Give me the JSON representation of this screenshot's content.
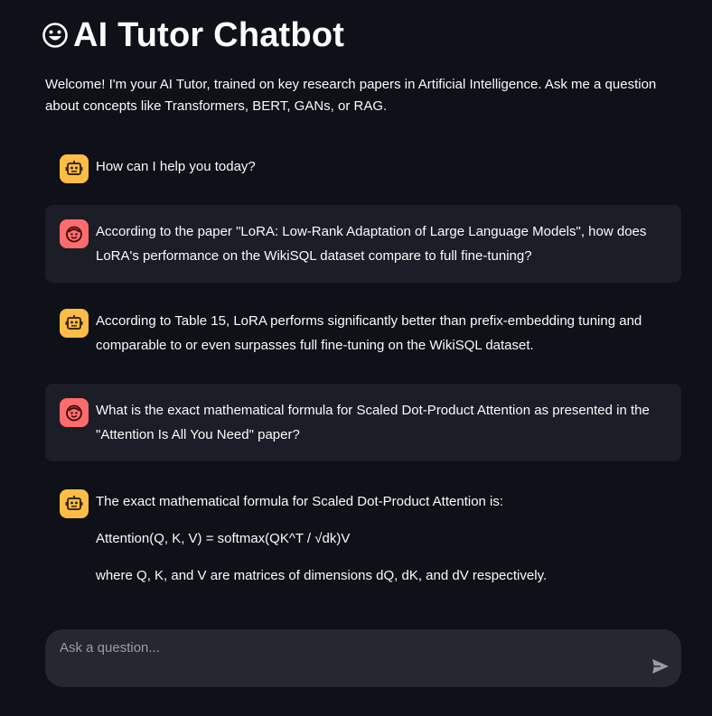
{
  "header": {
    "title": "AI Tutor Chatbot",
    "title_icon": "grinning-face-icon"
  },
  "welcome_text": "Welcome! I'm your AI Tutor, trained on key research papers in Artificial Intelligence. Ask me a question about concepts like Transformers, BERT, GANs, or RAG.",
  "messages": [
    {
      "role": "assistant",
      "icon": "robot-face-icon",
      "paragraphs": [
        "How can I help you today?"
      ]
    },
    {
      "role": "user",
      "icon": "smiley-face-icon",
      "paragraphs": [
        "According to the paper \"LoRA: Low-Rank Adaptation of Large Language Models\", how does LoRA's performance on the WikiSQL dataset compare to full fine-tuning?"
      ]
    },
    {
      "role": "assistant",
      "icon": "robot-face-icon",
      "paragraphs": [
        "According to Table 15, LoRA performs significantly better than prefix-embedding tuning and comparable to or even surpasses full fine-tuning on the WikiSQL dataset."
      ]
    },
    {
      "role": "user",
      "icon": "smiley-face-icon",
      "paragraphs": [
        "What is the exact mathematical formula for Scaled Dot-Product Attention as presented in the \"Attention Is All You Need\" paper?"
      ]
    },
    {
      "role": "assistant",
      "icon": "robot-face-icon",
      "paragraphs": [
        "The exact mathematical formula for Scaled Dot-Product Attention is:",
        "Attention(Q, K, V) = softmax(QK^T / √dk)V",
        "where Q, K, and V are matrices of dimensions dQ, dK, and dV respectively."
      ]
    }
  ],
  "chat_input": {
    "placeholder": "Ask a question...",
    "value": "",
    "send_icon": "send-arrow-icon"
  },
  "colors": {
    "background": "#0e1117",
    "user_message_bg": "#1b1e27",
    "assistant_avatar": "#ffbd45",
    "user_avatar": "#ff6c6c",
    "input_bg": "#262730",
    "text": "#fafafa"
  }
}
